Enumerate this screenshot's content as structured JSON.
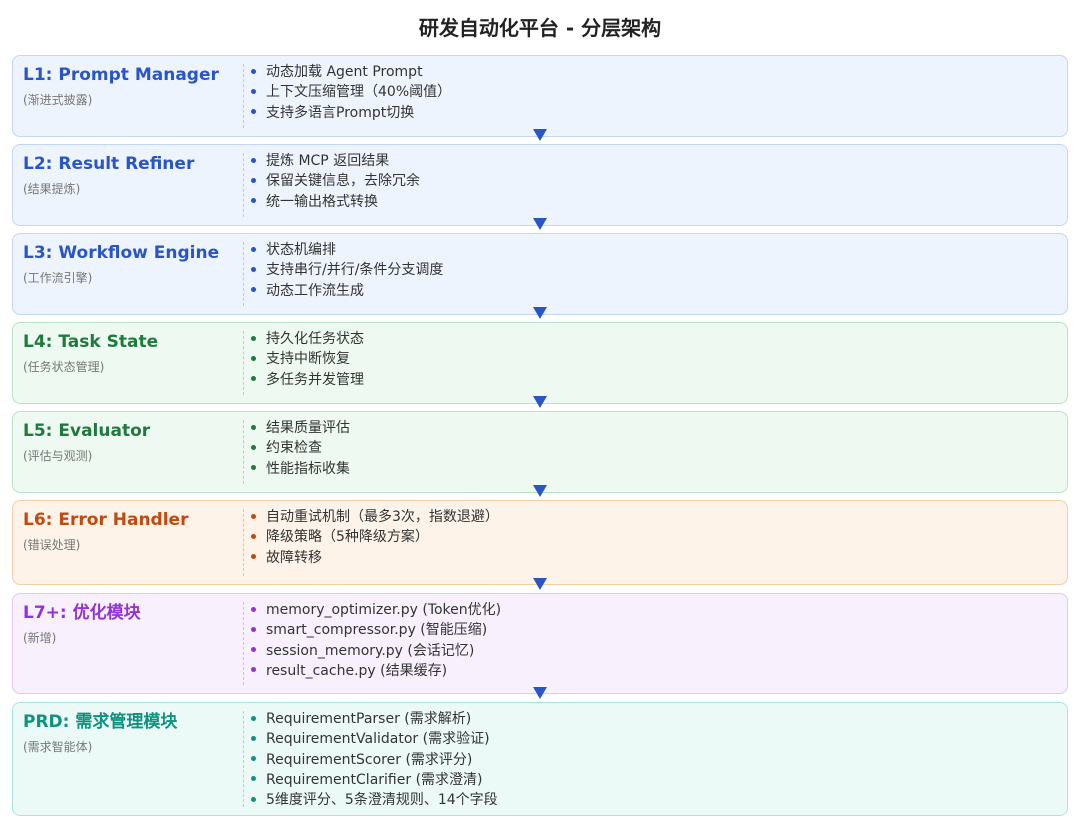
{
  "title": "研发自动化平台 - 分层架构",
  "colors": {
    "blue": "#2a55c7",
    "green": "#1f7a3e",
    "orange": "#c24a10",
    "purple": "#9333d6",
    "teal": "#11917f",
    "arrow": "#2a55c7"
  },
  "layers": [
    {
      "name": "L1: Prompt Manager",
      "subtitle": "(渐进式披露)",
      "items": [
        "动态加载 Agent Prompt",
        "上下文压缩管理（40%阈值）",
        "支持多语言Prompt切换"
      ]
    },
    {
      "name": "L2: Result Refiner",
      "subtitle": "(结果提炼)",
      "items": [
        "提炼 MCP 返回结果",
        "保留关键信息，去除冗余",
        "统一输出格式转换"
      ]
    },
    {
      "name": "L3: Workflow Engine",
      "subtitle": "(工作流引擎)",
      "items": [
        "状态机编排",
        "支持串行/并行/条件分支调度",
        "动态工作流生成"
      ]
    },
    {
      "name": "L4: Task State",
      "subtitle": "(任务状态管理)",
      "items": [
        "持久化任务状态",
        "支持中断恢复",
        "多任务并发管理"
      ]
    },
    {
      "name": "L5: Evaluator",
      "subtitle": "(评估与观测)",
      "items": [
        "结果质量评估",
        "约束检查",
        "性能指标收集"
      ]
    },
    {
      "name": "L6: Error Handler",
      "subtitle": "(错误处理)",
      "items": [
        "自动重试机制（最多3次，指数退避）",
        "降级策略（5种降级方案）",
        "故障转移"
      ]
    },
    {
      "name": "L7+: 优化模块",
      "subtitle": "(新增)",
      "items": [
        "memory_optimizer.py (Token优化)",
        "smart_compressor.py (智能压缩)",
        "session_memory.py (会话记忆)",
        "result_cache.py (结果缓存)"
      ]
    },
    {
      "name": "PRD: 需求管理模块",
      "subtitle": "(需求智能体)",
      "items": [
        "RequirementParser (需求解析)",
        "RequirementValidator (需求验证)",
        "RequirementScorer (需求评分)",
        "RequirementClarifier (需求澄清)",
        "5维度评分、5条澄清规则、14个字段"
      ]
    }
  ]
}
